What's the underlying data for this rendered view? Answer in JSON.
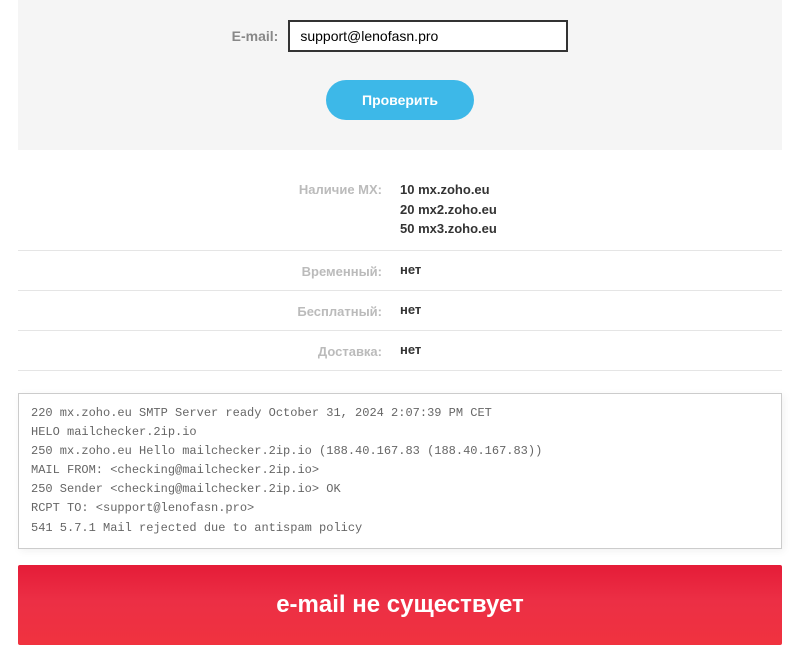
{
  "form": {
    "emailLabel": "E-mail:",
    "emailValue": "support@lenofasn.pro",
    "checkButton": "Проверить"
  },
  "results": {
    "mx": {
      "label": "Наличие MX:",
      "items": [
        {
          "priority": "10",
          "host": "mx.zoho.eu"
        },
        {
          "priority": "20",
          "host": "mx2.zoho.eu"
        },
        {
          "priority": "50",
          "host": "mx3.zoho.eu"
        }
      ]
    },
    "temporary": {
      "label": "Временный:",
      "value": "нет"
    },
    "free": {
      "label": "Бесплатный:",
      "value": "нет"
    },
    "delivery": {
      "label": "Доставка:",
      "value": "нет"
    }
  },
  "smtpLog": "220 mx.zoho.eu SMTP Server ready October 31, 2024 2:07:39 PM CET\nHELO mailchecker.2ip.io\n250 mx.zoho.eu Hello mailchecker.2ip.io (188.40.167.83 (188.40.167.83))\nMAIL FROM: <checking@mailchecker.2ip.io>\n250 Sender <checking@mailchecker.2ip.io> OK\nRCPT TO: <support@lenofasn.pro>\n541 5.7.1 Mail rejected due to antispam policy",
  "status": {
    "message": "e-mail не существует"
  }
}
